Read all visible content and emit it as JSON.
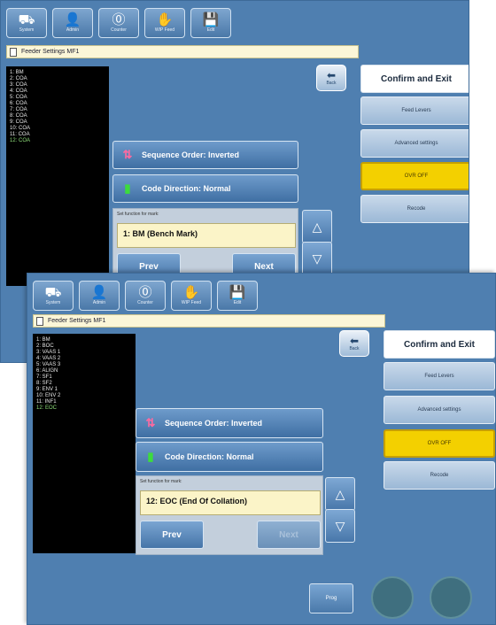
{
  "toolbar": {
    "items": [
      {
        "icon": "conveyor-icon",
        "glyph": "⛟",
        "label": "System"
      },
      {
        "icon": "user-icon",
        "glyph": "👤",
        "label": "Admin"
      },
      {
        "icon": "counter-icon",
        "glyph": "⓪",
        "label": "Counter"
      },
      {
        "icon": "hand-icon",
        "glyph": "✋",
        "label": "WIP Feed"
      },
      {
        "icon": "save-icon",
        "glyph": "💾",
        "label": "Edit"
      }
    ]
  },
  "window_title": "Feeder Settings MF1",
  "back_label": "Back",
  "right_buttons": {
    "confirm": "Confirm and Exit",
    "feed_levers": "Feed Levers",
    "advanced": "Advanced settings",
    "ovr": "OVR OFF",
    "recode": "Recode"
  },
  "sequence_label": "Sequence Order: Inverted",
  "code_direction_label": "Code Direction: Normal",
  "set_function_label": "Set function for mark:",
  "prev_label": "Prev",
  "next_label": "Next",
  "screen1": {
    "list": [
      "1: BM",
      "2: COA",
      "3: COA",
      "4: COA",
      "5: COA",
      "6: COA",
      "7: COA",
      "8: COA",
      "9: COA",
      "10: COA",
      "11: COA",
      "12: COA"
    ],
    "selected_index": 11,
    "field_value": "1: BM (Bench Mark)"
  },
  "screen2": {
    "list": [
      "1: BM",
      "2: BOC",
      "3: VAAS 1",
      "4: VAAS 2",
      "5: VAAS 3",
      "6: ALIGN",
      "7: SF1",
      "8: SF2",
      "9: ENV 1",
      "10: ENV 2",
      "11: INF1",
      "12: EOC"
    ],
    "selected_index": 11,
    "field_value": "12: EOC (End Of Collation)",
    "prog_label": "Prog"
  },
  "colors": {
    "panel": "#4f7fb0",
    "accent_yellow": "#f3d000",
    "field_yellow": "#fbf4c8"
  }
}
